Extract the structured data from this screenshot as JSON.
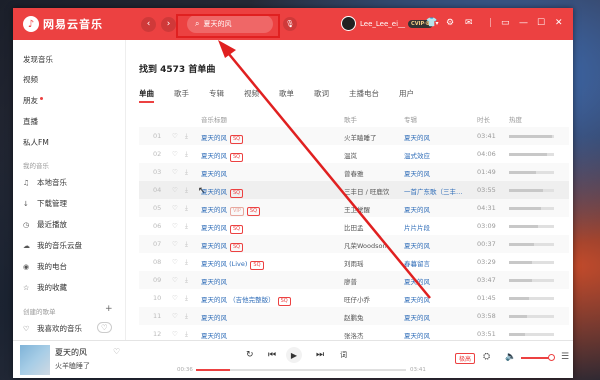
{
  "app": {
    "name": "网易云音乐",
    "logo_glyph": "♪"
  },
  "titlebar": {
    "back": "‹",
    "forward": "›",
    "search_value": "夏天的风",
    "search_icon": "⌕",
    "mic_icon": "🎙",
    "username": "Lee_Lee_ei__",
    "vip_badge": "CVIP·8",
    "icons": {
      "skin": "👕",
      "settings": "⚙",
      "mail": "✉",
      "mini": "▭",
      "minimize": "—",
      "maximize": "☐",
      "close": "✕"
    }
  },
  "sidebar": {
    "top_items": [
      "发现音乐",
      "视频",
      "朋友",
      "直播",
      "私人FM"
    ],
    "my_music_header": "我的音乐",
    "my_music_items": [
      {
        "icon": "♫",
        "label": "本地音乐"
      },
      {
        "icon": "↓",
        "label": "下载管理"
      },
      {
        "icon": "◷",
        "label": "最近播放"
      },
      {
        "icon": "☁",
        "label": "我的音乐云盘"
      },
      {
        "icon": "◉",
        "label": "我的电台"
      },
      {
        "icon": "☆",
        "label": "我的收藏"
      }
    ],
    "created_header": "创建的歌单",
    "add_icon": "+",
    "created_items": [
      {
        "icon": "♡",
        "label": "我喜欢的音乐"
      }
    ]
  },
  "main": {
    "result_title": "找到 4573 首单曲",
    "tabs": [
      "单曲",
      "歌手",
      "专辑",
      "视频",
      "歌单",
      "歌词",
      "主播电台",
      "用户"
    ],
    "columns": {
      "title": "音乐标题",
      "artist": "歌手",
      "album": "专辑",
      "duration": "时长",
      "hot": "热度"
    },
    "rows": [
      {
        "num": "01",
        "title": "夏天的风",
        "tags": [
          "SQ"
        ],
        "artist": "火羊瞌睡了",
        "album": "夏天的风",
        "duration": "03:41",
        "hot": 0.95
      },
      {
        "num": "02",
        "title": "夏天的风",
        "tags": [
          "SQ"
        ],
        "artist": "温岚",
        "album": "温式效应",
        "duration": "04:06",
        "hot": 0.85
      },
      {
        "num": "03",
        "title": "夏天的风",
        "tags": [],
        "artist": "曾春雅",
        "album": "夏天的风",
        "duration": "01:49",
        "hot": 0.6
      },
      {
        "num": "04",
        "title": "夏天的风",
        "tags": [
          "SQ"
        ],
        "artist": "三丰日 / 旺鹿饮",
        "album": "一首广东歌（三丰…",
        "duration": "03:55",
        "hot": 0.75
      },
      {
        "num": "05",
        "title": "夏天的风",
        "tags": [
          "VIP",
          "SQ"
        ],
        "artist": "王卫觉醒",
        "album": "夏天的风",
        "duration": "04:31",
        "hot": 0.7
      },
      {
        "num": "06",
        "title": "夏天的风",
        "tags": [
          "SQ"
        ],
        "artist": "比田孟",
        "album": "片片片段",
        "duration": "03:09",
        "hot": 0.65
      },
      {
        "num": "07",
        "title": "夏天的风",
        "tags": [
          "SQ"
        ],
        "artist": "凡荣Woodson",
        "album": "夏天的风",
        "duration": "00:37",
        "hot": 0.55
      },
      {
        "num": "08",
        "title": "夏天的风 (Live)",
        "tags": [
          "SQ"
        ],
        "artist": "刘雨瑶",
        "album": "春暮留言",
        "duration": "03:29",
        "hot": 0.5
      },
      {
        "num": "09",
        "title": "夏天的风",
        "tags": [],
        "artist": "廖普",
        "album": "夏天的风",
        "duration": "03:47",
        "hot": 0.5
      },
      {
        "num": "10",
        "title": "夏天的风 （吉他完整版）",
        "tags": [
          "SQ"
        ],
        "artist": "旺仔小乔",
        "album": "夏天的风",
        "duration": "01:45",
        "hot": 0.45
      },
      {
        "num": "11",
        "title": "夏天的风",
        "tags": [],
        "artist": "赵鹏兔",
        "album": "夏天的风",
        "duration": "03:58",
        "hot": 0.4
      },
      {
        "num": "12",
        "title": "夏天的风",
        "tags": [],
        "artist": "张洛杰",
        "album": "夏天的风",
        "duration": "03:51",
        "hot": 0.35
      }
    ]
  },
  "player": {
    "title": "夏天的风",
    "artist": "火羊瞌睡了",
    "heart_icon": "♡",
    "elapsed": "00:36",
    "total": "03:41",
    "progress": 0.16,
    "loop_icon": "↻",
    "prev_icon": "⏮",
    "play_icon": "▶",
    "next_icon": "⏭",
    "lyric_icon": "词",
    "quality": "极高",
    "listen_icon": "⛭",
    "volume_icon": "🔈",
    "playlist_icon": "☰"
  },
  "colors": {
    "accent": "#ec4141",
    "link": "#2f6db8",
    "annotation": "#e02020"
  }
}
